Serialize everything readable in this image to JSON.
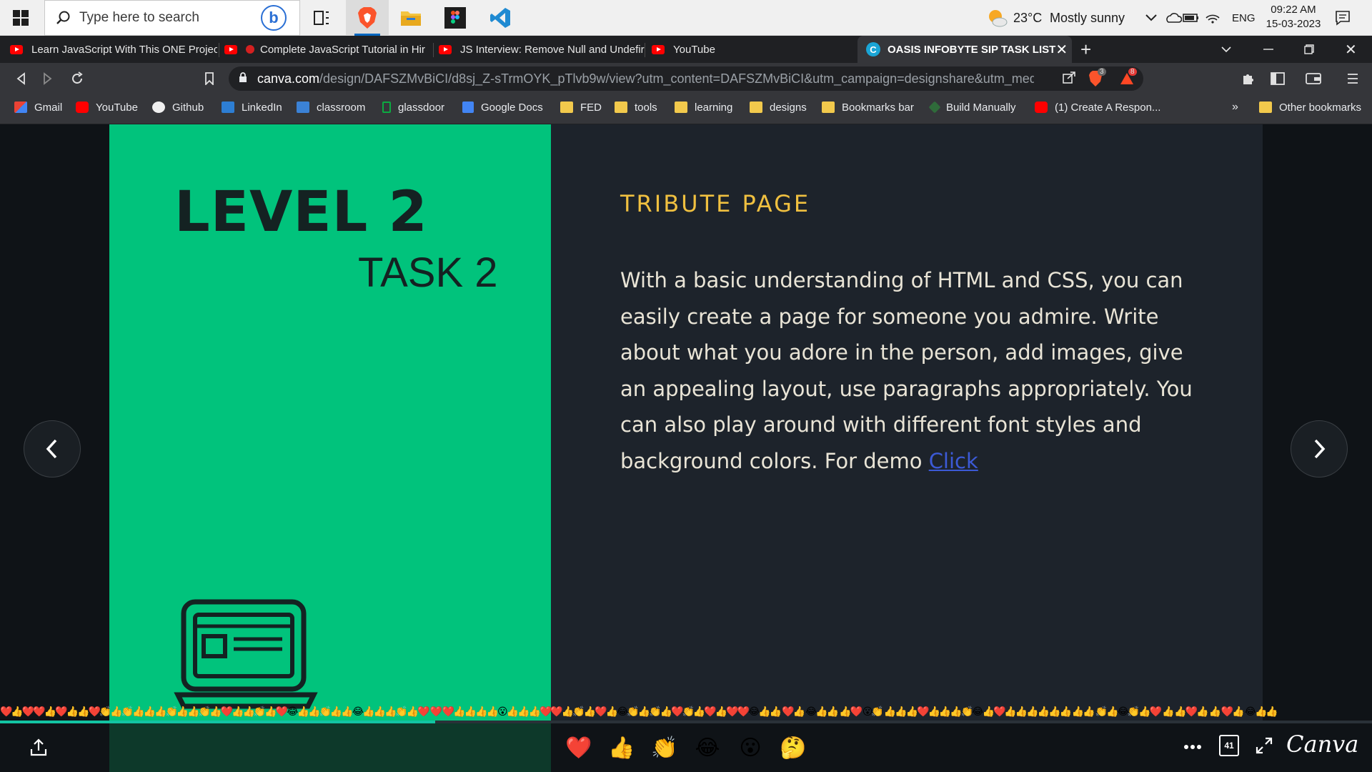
{
  "taskbar": {
    "search_placeholder": "Type here to search",
    "weather": {
      "temp": "23°C",
      "condition": "Mostly sunny"
    },
    "language": "ENG",
    "time": "09:22 AM",
    "date": "15-03-2023"
  },
  "browser": {
    "tabs": [
      {
        "title": "Learn JavaScript With This ONE Projec",
        "kind": "youtube"
      },
      {
        "title": "Complete JavaScript Tutorial in Hir",
        "kind": "youtube"
      },
      {
        "title": "JS Interview: Remove Null and Undefir",
        "kind": "youtube"
      },
      {
        "title": "YouTube",
        "kind": "youtube"
      },
      {
        "title": "OASIS INFOBYTE SIP TASK LIST",
        "kind": "canva",
        "active": true
      }
    ],
    "new_tab_label": "+",
    "url_domain": "canva.com",
    "url_path": "/design/DAFSZMvBiCI/d8sj_Z-sTrmOYK_pTlvb9w/view?utm_content=DAFSZMvBiCI&utm_campaign=designshare&utm_medium=l...",
    "brave_badge": "3",
    "rewards_badge": "8",
    "bookmarks": [
      {
        "label": "Gmail",
        "icon": "gmail-icon"
      },
      {
        "label": "YouTube",
        "icon": "youtube-icon"
      },
      {
        "label": "Github",
        "icon": "github-icon"
      },
      {
        "label": "LinkedIn",
        "icon": "linkedin-icon"
      },
      {
        "label": "classroom",
        "icon": "classroom-icon"
      },
      {
        "label": "glassdoor",
        "icon": "glassdoor-icon"
      },
      {
        "label": "Google Docs",
        "icon": "docs-icon"
      },
      {
        "label": "FED",
        "icon": "folder-icon"
      },
      {
        "label": "tools",
        "icon": "folder-icon"
      },
      {
        "label": "learning",
        "icon": "folder-icon"
      },
      {
        "label": "designs",
        "icon": "folder-icon"
      },
      {
        "label": "Bookmarks bar",
        "icon": "folder-icon"
      },
      {
        "label": "Build Manually",
        "icon": "build-icon"
      },
      {
        "label": "(1) Create A Respon...",
        "icon": "youtube-icon"
      }
    ],
    "overflow_label": "»",
    "other_bookmarks": "Other bookmarks"
  },
  "slide": {
    "level": "LEVEL 2",
    "task": "TASK 2",
    "heading": "TRIBUTE PAGE",
    "body": "With a basic understanding of HTML and CSS, you can easily create a page for someone you admire. Write about what you adore in the person, add images, give an appealing layout, use paragraphs appropriately. You can also play around with different font styles and background colors. For demo ",
    "link_text": "Click",
    "left_color": "#01c37c",
    "right_color": "#1d232b",
    "heading_color": "#f0c040"
  },
  "reactions_strip": "❤️👍❤️❤️👍❤️👍👍❤️👏👍👏👍👍👍👏👍👍👏👍❤️👍👍👏👍❤️😂👍👍👏👍👍😂👍👍👍👏👍❤️   ❤️   ❤️👍👍👍👍😮👍👍👍❤️❤️👍👏👍❤️👍😂👏👍👏👍❤️👏👍❤️👍❤️❤️😂👍👍 ❤️👍 😂👍👍 👍❤️  😮👏 👍👍👍❤️👍👍👍👏😂👍❤️👍👍👍👍👍👍 👍👍 👏👍😂👏👍❤️  👍  👍❤️👍    👍   ❤️👍 😂👍👍",
  "bottombar": {
    "reactions": [
      "❤️",
      "👍",
      "👏",
      "😂",
      "😮",
      "🤔"
    ],
    "page_count": "41",
    "progress": 0.317,
    "brand": "Canva"
  }
}
